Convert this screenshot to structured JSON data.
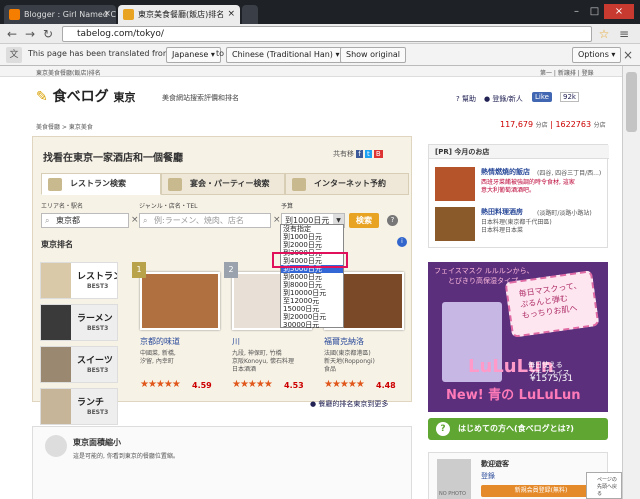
{
  "browser": {
    "tabs": [
      {
        "title": "Blogger : Girl Named Cat"
      },
      {
        "title": "東京美食餐廳(飯店)排名"
      }
    ],
    "url": "tabelog.com/tokyo/",
    "translate": {
      "text_before": "This page has been translated from",
      "from_lang": "Japanese",
      "to_word": "to",
      "to_lang": "Chinese (Traditional Han)",
      "show_original": "Show original",
      "options": "Options"
    }
  },
  "header": {
    "topline_left": "東京美食餐廳(飯店)排名",
    "topline_right": "第一 | 新讓排 | 登錄",
    "logo_main": "食べログ",
    "logo_area": "東京",
    "tagline": "美食網站搜索評價和排名",
    "help": "幫助",
    "login": "登錄/新人",
    "like": "Like",
    "like_count": "92k"
  },
  "breadcrumb": "美食餐廳 > 東京美食",
  "counts": {
    "shops": "117,679",
    "shops_unit": "分店",
    "reviews": "1622763",
    "reviews_unit": "分店"
  },
  "search": {
    "title": "找看在東京一家酒店和一個餐廳",
    "share": "共有移",
    "tabs": [
      {
        "label": "レストラン検索"
      },
      {
        "label": "宴会・パーティー検索"
      },
      {
        "label": "インターネット予約"
      }
    ],
    "area_label": "エリア名・駅名",
    "area_value": "東京都",
    "genre_label": "ジャンル・店名・TEL",
    "genre_placeholder": "例:ラーメン、焼肉、店名",
    "budget_label": "予算",
    "budget_value": "到1000日元",
    "search_button": "検索",
    "help": "?",
    "budget_options": [
      "沒有指定",
      "到1000日元",
      "到2000日元",
      "到3000日元",
      "到4000日元",
      "到5000日元",
      "到6000日元",
      "到8000日元",
      "到10000日元",
      "至12000元",
      "15000日元",
      "到20000日元",
      "30000日元"
    ],
    "budget_selected_index": 5
  },
  "ranking": {
    "title": "東京排名",
    "categories": [
      {
        "label": "レストラン",
        "best": "BEST3"
      },
      {
        "label": "ラーメン",
        "best": "BEST3"
      },
      {
        "label": "スイーツ",
        "best": "BEST3"
      },
      {
        "label": "ランチ",
        "best": "BEST3"
      }
    ],
    "cards": [
      {
        "rank": "1",
        "name": "京都的味道",
        "desc": [
          "中國菜, 新橋,",
          "汐留, 內幸町"
        ],
        "stars": "★★★★★",
        "score": "4.59"
      },
      {
        "rank": "2",
        "name": "川",
        "desc": [
          "九段, 神保町, 竹橋",
          "京阪Konoyu, 懷石料理",
          "日本酒酒"
        ],
        "stars": "★★★★★",
        "score": "4.53"
      },
      {
        "rank": "3",
        "name": "福爾克納洛",
        "desc": [
          "法國(東京都港區)",
          "新天地(Roppongi)",
          "食品"
        ],
        "stars": "★★★★★",
        "score": "4.48"
      }
    ],
    "more": "餐廳的排名東京到更多"
  },
  "map": {
    "title": "東京面積縮小",
    "desc": "這是可能的, 你看到東京的餐廳位置縮。"
  },
  "pr": {
    "title": "[PR] 今月のお店",
    "items": [
      {
        "name": "熱情燃燒的飯店",
        "sub": "(四谷, 四谷三丁目/西...)",
        "desc": [
          "西班牙菜餚被強調的時令食材, 這家",
          "意大利葡萄酒酒吧。"
        ]
      },
      {
        "name": "熱田料理酒房",
        "sub": "(淡路町/淡路小路站)",
        "desc": [
          "日本料理(東京都千代田區)",
          "日本料理日本菜"
        ]
      }
    ]
  },
  "ad": {
    "top": "フェイスマスク ルルルンから、",
    "top2": "とびきり高保湿タイプ",
    "bubble": [
      "毎日マスクって、",
      "ぷるんと弾む",
      "もっちりお肌へ"
    ],
    "brand": "LuLuLun",
    "price": "¥1575/31",
    "new": "New! 青の LuLuLun",
    "bottom": "毎日使える",
    "bottom2": "プチプライス"
  },
  "green": {
    "label": "はじめての方へ(食べログとは?)",
    "icon": "?"
  },
  "guest": {
    "no_photo": "NO PHOTO",
    "title": "歡迎遊客",
    "login": "登錄",
    "register": "新規会員登録(無料)"
  },
  "overlay": {
    "text": "ページの先頭へ戻る"
  },
  "colors": {
    "accent": "#e8a323",
    "tab_bg": "#1e2126",
    "highlight": "#e0105a",
    "green": "#5fa632",
    "ad_purple": "#5b2f7c"
  }
}
